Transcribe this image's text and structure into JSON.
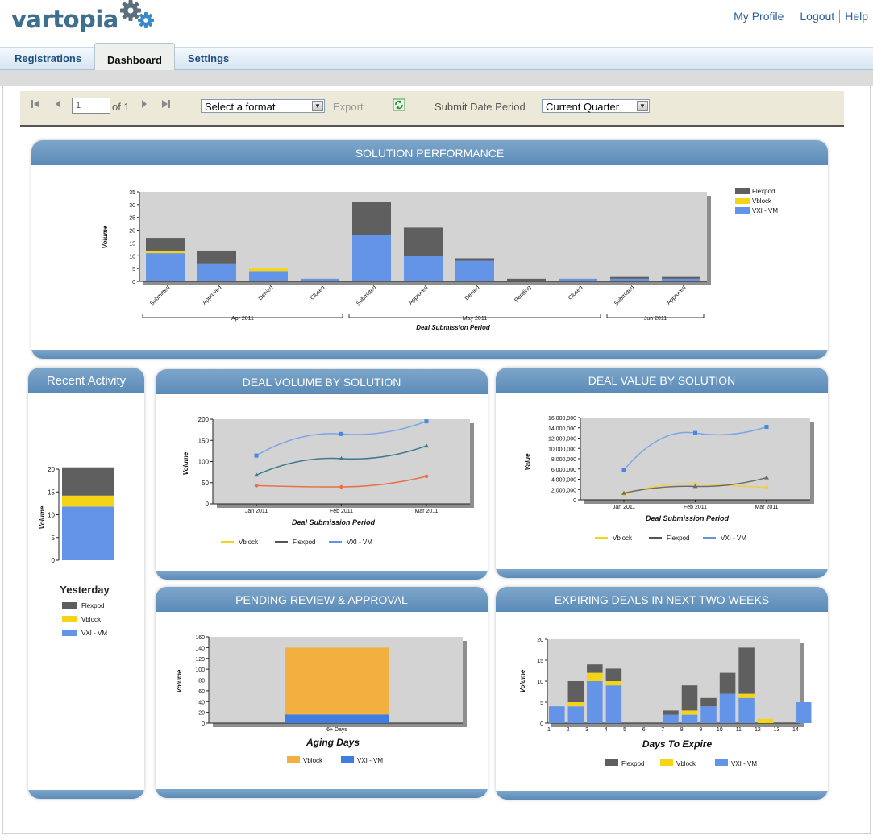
{
  "app": {
    "logo_text": "vartopia"
  },
  "header_links": {
    "my_profile": "My Profile",
    "logout": "Logout",
    "help": "Help"
  },
  "tabs": [
    {
      "label": "Registrations",
      "active": false
    },
    {
      "label": "Dashboard",
      "active": true
    },
    {
      "label": "Settings",
      "active": false
    }
  ],
  "toolbar": {
    "page_value": "1",
    "page_of": "of 1",
    "format_select": "Select a format",
    "export_label": "Export",
    "period_label": "Submit Date Period",
    "period_select": "Current Quarter",
    "icons": [
      "first-page-icon",
      "prev-page-icon",
      "next-page-icon",
      "last-page-icon",
      "refresh-icon"
    ]
  },
  "colors": {
    "flexpod": "#5f5f5f",
    "vblock": "#f5d418",
    "vxi": "#6394e8",
    "vblock_pending": "#f2b040",
    "vxi_pending": "#3f7ee0",
    "panel_header": "#6793bf",
    "plot_bg": "#d3d3d3"
  },
  "panels": {
    "solution_performance": "SOLUTION PERFORMANCE",
    "recent_activity": "Recent Activity",
    "deal_volume": "DEAL VOLUME BY SOLUTION",
    "deal_value": "DEAL VALUE BY SOLUTION",
    "pending": "PENDING REVIEW & APPROVAL",
    "expiring": "EXPIRING DEALS IN NEXT TWO WEEKS"
  },
  "chart_data": [
    {
      "id": "solution_performance",
      "type": "bar",
      "stacked": true,
      "categories": [
        "Submitted",
        "Approved",
        "Denied",
        "Closed",
        "Submitted",
        "Approved",
        "Denied",
        "Pending",
        "Closed",
        "Submitted",
        "Approved"
      ],
      "groups": [
        {
          "label": "Apr 2011",
          "from": 0,
          "to": 3
        },
        {
          "label": "May 2011",
          "from": 4,
          "to": 8
        },
        {
          "label": "Jun 2011",
          "from": 9,
          "to": 10
        }
      ],
      "series": [
        {
          "name": "VXI - VM",
          "values": [
            11,
            7,
            4,
            1,
            18,
            10,
            8,
            0,
            1,
            1,
            1
          ]
        },
        {
          "name": "Vblock",
          "values": [
            1,
            0,
            1,
            0,
            0,
            0,
            0,
            0,
            0,
            0,
            0
          ]
        },
        {
          "name": "Flexpod",
          "values": [
            5,
            5,
            0,
            0,
            13,
            11,
            1,
            1,
            0,
            1,
            1
          ]
        }
      ],
      "xlabel": "Deal Submission Period",
      "ylabel": "Volume",
      "ylim": [
        0,
        35
      ],
      "yticks": [
        0,
        5,
        10,
        15,
        20,
        25,
        30,
        35
      ],
      "legend": [
        "Flexpod",
        "Vblock",
        "VXI - VM"
      ],
      "legend_position": "right"
    },
    {
      "id": "recent_activity",
      "type": "bar",
      "stacked": true,
      "categories": [
        ""
      ],
      "series": [
        {
          "name": "VXI - VM",
          "values": [
            11.8
          ]
        },
        {
          "name": "Vblock",
          "values": [
            2.4
          ]
        },
        {
          "name": "Flexpod",
          "values": [
            6.2
          ]
        }
      ],
      "title": "Yesterday",
      "ylabel": "Volume",
      "ylim": [
        0,
        20
      ],
      "yticks": [
        0,
        5,
        10,
        15,
        20
      ],
      "legend": [
        "Flexpod",
        "Vblock",
        "VXI - VM"
      ],
      "legend_position": "bottom"
    },
    {
      "id": "deal_volume",
      "type": "line",
      "x": [
        "Jan 2011",
        "Feb 2011",
        "Mar 2011"
      ],
      "series": [
        {
          "name": "Vblock",
          "values": [
            43,
            40,
            65
          ]
        },
        {
          "name": "Flexpod",
          "values": [
            68,
            107,
            137
          ]
        },
        {
          "name": "VXI - VM",
          "values": [
            114,
            165,
            195
          ]
        }
      ],
      "xlabel": "Deal Submission Period",
      "ylabel": "Volume",
      "ylim": [
        0,
        200
      ],
      "yticks": [
        0,
        50,
        100,
        150,
        200
      ],
      "legend": [
        "Vblock",
        "Flexpod",
        "VXI - VM"
      ],
      "legend_position": "bottom"
    },
    {
      "id": "deal_value",
      "type": "line",
      "x": [
        "Jan 2011",
        "Feb 2011",
        "Mar 2011"
      ],
      "series": [
        {
          "name": "Vblock",
          "values": [
            1000000,
            3100000,
            2400000
          ]
        },
        {
          "name": "Flexpod",
          "values": [
            1300000,
            2600000,
            4300000
          ]
        },
        {
          "name": "VXI - VM",
          "values": [
            5800000,
            13000000,
            14200000
          ]
        }
      ],
      "xlabel": "Deal Submission Period",
      "ylabel": "Value",
      "ylim": [
        0,
        16000000
      ],
      "yticks": [
        "0",
        "2,000,000",
        "4,000,000",
        "6,000,000",
        "8,000,000",
        "10,000,000",
        "12,000,000",
        "14,000,000",
        "16,000,000"
      ],
      "legend": [
        "Vblock",
        "Flexpod",
        "VXI - VM"
      ],
      "legend_position": "bottom"
    },
    {
      "id": "pending",
      "type": "bar",
      "stacked": true,
      "categories": [
        "6+ Days"
      ],
      "series": [
        {
          "name": "VXI - VM",
          "values": [
            16
          ]
        },
        {
          "name": "Vblock",
          "values": [
            124
          ]
        }
      ],
      "xlabel": "Aging Days",
      "ylabel": "Volume",
      "ylim": [
        0,
        160
      ],
      "yticks": [
        0,
        20,
        40,
        60,
        80,
        100,
        120,
        140,
        160
      ],
      "legend": [
        "Vblock",
        "VXI - VM"
      ],
      "legend_position": "bottom"
    },
    {
      "id": "expiring",
      "type": "bar",
      "stacked": true,
      "categories": [
        "1",
        "2",
        "3",
        "4",
        "5",
        "6",
        "7",
        "8",
        "9",
        "10",
        "11",
        "12",
        "13",
        "14"
      ],
      "series": [
        {
          "name": "VXI - VM",
          "values": [
            4,
            4,
            10,
            9,
            0,
            0,
            2,
            2,
            4,
            7,
            6,
            0,
            0,
            5
          ]
        },
        {
          "name": "Vblock",
          "values": [
            0,
            1,
            2,
            1,
            0,
            0,
            0,
            1,
            0,
            0,
            1,
            1,
            0,
            0
          ]
        },
        {
          "name": "Flexpod",
          "values": [
            0,
            5,
            2,
            3,
            0,
            0,
            1,
            6,
            2,
            5,
            11,
            0,
            0,
            0
          ]
        }
      ],
      "xlabel": "Days To Expire",
      "ylabel": "Volume",
      "ylim": [
        0,
        20
      ],
      "yticks": [
        0,
        5,
        10,
        15,
        20
      ],
      "legend": [
        "Flexpod",
        "Vblock",
        "VXI - VM"
      ],
      "legend_position": "bottom"
    }
  ]
}
